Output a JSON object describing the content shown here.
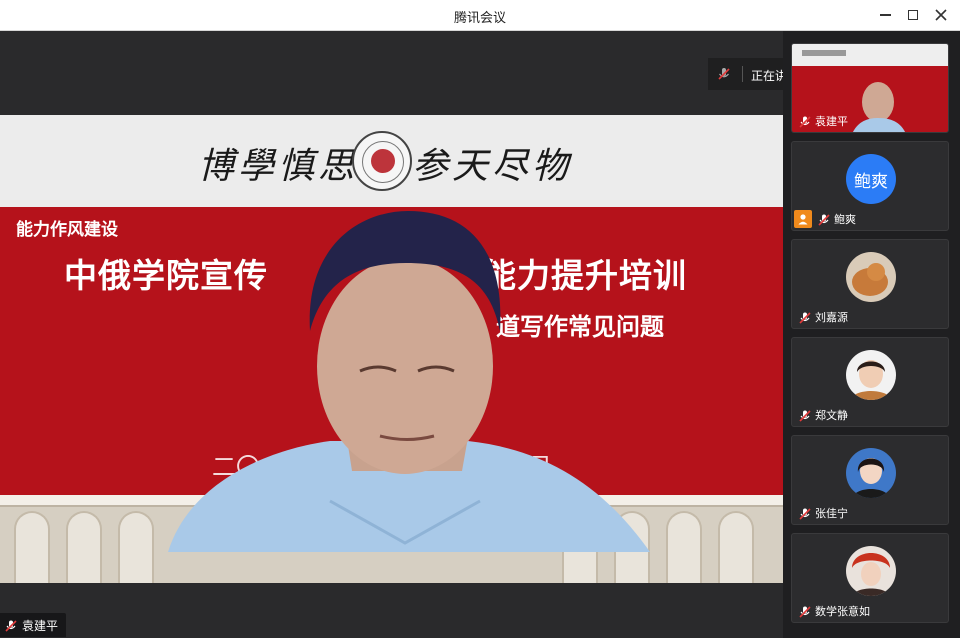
{
  "window": {
    "title": "腾讯会议"
  },
  "slide": {
    "motto_left": "博學慎思",
    "motto_right": "参天尽物",
    "tag": "能力作风建设",
    "headline_left": "中俄学院宣传",
    "headline_right": "能力提升培训",
    "subline": "道写作常见问题",
    "date_left": "二〇",
    "date_right": "月"
  },
  "speaking": {
    "label": "正在讲话:"
  },
  "stage_speaker": {
    "name": "袁建平"
  },
  "participants": [
    {
      "name": "袁建平",
      "avatar": "video-thumbnail"
    },
    {
      "name": "鲍爽",
      "avatar_text": "鲍爽",
      "host": true
    },
    {
      "name": "刘嘉源",
      "avatar": "cat-photo"
    },
    {
      "name": "郑文静",
      "avatar": "portrait-photo"
    },
    {
      "name": "张佳宁",
      "avatar": "portrait-photo"
    },
    {
      "name": "数学张意如",
      "avatar": "costume-photo"
    }
  ],
  "colors": {
    "slide_red": "#b5121b",
    "accent_blue": "#2b7cf6",
    "host_orange": "#f08a1c",
    "mic_red": "#e23b3b"
  }
}
